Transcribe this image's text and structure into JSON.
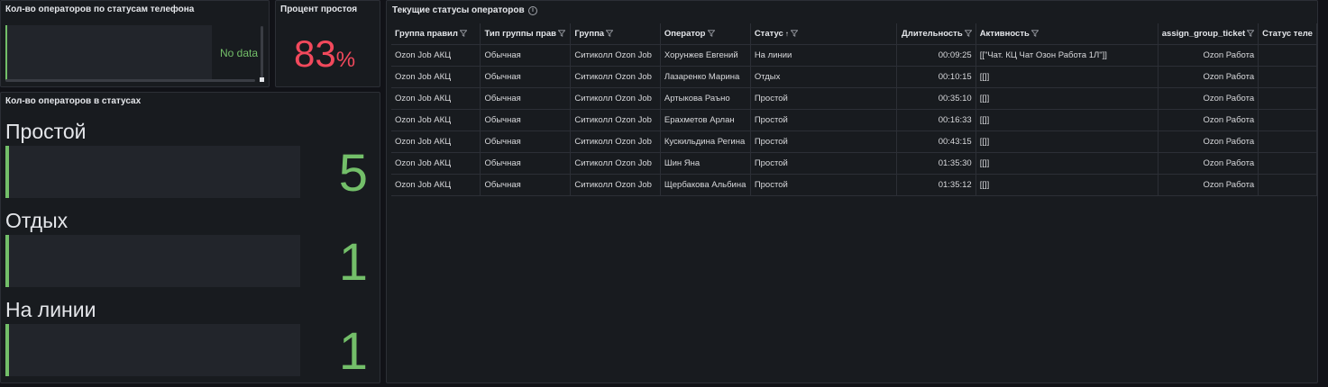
{
  "panel1": {
    "title": "Кол-во операторов по статусам телефона",
    "no_data": "No data"
  },
  "panel2": {
    "title": "Процент простоя",
    "value": "83",
    "unit": "%"
  },
  "panel3": {
    "title": "Кол-во операторов в статусах",
    "items": [
      {
        "label": "Простой",
        "value": "5",
        "fill": 0.01
      },
      {
        "label": "Отдых",
        "value": "1",
        "fill": 0.005
      },
      {
        "label": "На линии",
        "value": "1",
        "fill": 0.005
      }
    ]
  },
  "panel4": {
    "title": "Текущие статусы операторов",
    "columns": [
      "Группа правил",
      "Тип группы прав",
      "Группа",
      "Оператор",
      "Статус",
      "Длительность",
      "Активность",
      "assign_group_ticket",
      "Статус теле"
    ],
    "rows": [
      [
        "Ozon Job АКЦ",
        "Обычная",
        "Ситиколл Ozon Job",
        "Хорунжев Евгений",
        "На линии",
        "00:09:25",
        "[[\"Чат. КЦ Чат Озон Работа 1Л\"]]",
        "Ozon Работа",
        ""
      ],
      [
        "Ozon Job АКЦ",
        "Обычная",
        "Ситиколл Ozon Job",
        "Лазаренко Марина",
        "Отдых",
        "00:10:15",
        "[[]]",
        "Ozon Работа",
        ""
      ],
      [
        "Ozon Job АКЦ",
        "Обычная",
        "Ситиколл Ozon Job",
        "Артыкова Раъно",
        "Простой",
        "00:35:10",
        "[[]]",
        "Ozon Работа",
        ""
      ],
      [
        "Ozon Job АКЦ",
        "Обычная",
        "Ситиколл Ozon Job",
        "Ерахметов Арлан",
        "Простой",
        "00:16:33",
        "[[]]",
        "Ozon Работа",
        ""
      ],
      [
        "Ozon Job АКЦ",
        "Обычная",
        "Ситиколл Ozon Job",
        "Кускильдина Регина",
        "Простой",
        "00:43:15",
        "[[]]",
        "Ozon Работа",
        ""
      ],
      [
        "Ozon Job АКЦ",
        "Обычная",
        "Ситиколл Ozon Job",
        "Шин Яна",
        "Простой",
        "01:35:30",
        "[[]]",
        "Ozon Работа",
        ""
      ],
      [
        "Ozon Job АКЦ",
        "Обычная",
        "Ситиколл Ozon Job",
        "Щербакова Альбина",
        "Простой",
        "01:35:12",
        "[[]]",
        "Ozon Работа",
        ""
      ]
    ]
  },
  "colors": {
    "accent_green": "#73bf69",
    "accent_red": "#f2495c",
    "panel_bg": "#181b1f",
    "page_bg": "#111217"
  }
}
